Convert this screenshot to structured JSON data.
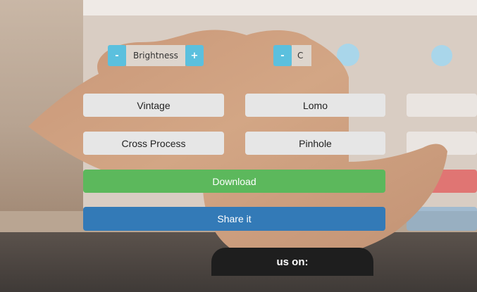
{
  "controls": {
    "brightness": {
      "minus": "-",
      "label": "Brightness",
      "plus": "+"
    },
    "second": {
      "minus": "-",
      "label": "C"
    }
  },
  "filters": {
    "vintage": "Vintage",
    "lomo": "Lomo",
    "cross_process": "Cross Process",
    "pinhole": "Pinhole"
  },
  "actions": {
    "download": "Download",
    "share": "Share it"
  },
  "footer": {
    "follow_text": "us on:"
  },
  "colors": {
    "info": "#5bc0de",
    "success": "#5cb85c",
    "primary": "#337ab7",
    "danger": "#e06565"
  }
}
